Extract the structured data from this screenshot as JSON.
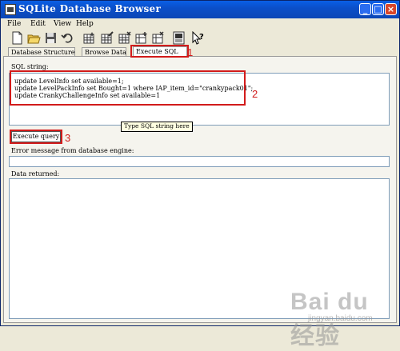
{
  "window": {
    "title": "SQLite Database Browser"
  },
  "titlebar_buttons": {
    "minimize": "_",
    "maximize": "□",
    "close": "×"
  },
  "menu": {
    "items": [
      "File",
      "Edit",
      "View",
      "Help"
    ]
  },
  "toolbar": {
    "icons": [
      "new-file-icon",
      "open-folder-icon",
      "save-icon",
      "undo-icon",
      "create-table-icon",
      "modify-table-icon",
      "delete-table-icon",
      "create-index-icon",
      "delete-index-icon",
      "sql-log-icon",
      "whats-this-icon"
    ]
  },
  "tabs": [
    {
      "label": "Database Structure"
    },
    {
      "label": "Browse Data"
    },
    {
      "label": "Execute SQL"
    }
  ],
  "sql": {
    "label": "SQL string:",
    "lines": [
      "update LevelInfo set available=1;",
      "update LevelPackInfo set Bought=1 where IAP_item_id=\"crankypack01\";",
      "update CrankyChallengeInfo set available=1"
    ],
    "tooltip": "Type SQL string here"
  },
  "execute_button": {
    "label": "Execute query"
  },
  "error": {
    "label": "Error message from database engine:",
    "value": ""
  },
  "data_returned": {
    "label": "Data returned:"
  },
  "annotations": {
    "n1": "1",
    "n2": "2",
    "n3": "3",
    "color": "#d21b1b"
  },
  "watermark": {
    "logo": "Bai du 经验",
    "url": "jingyan.baidu.com"
  }
}
